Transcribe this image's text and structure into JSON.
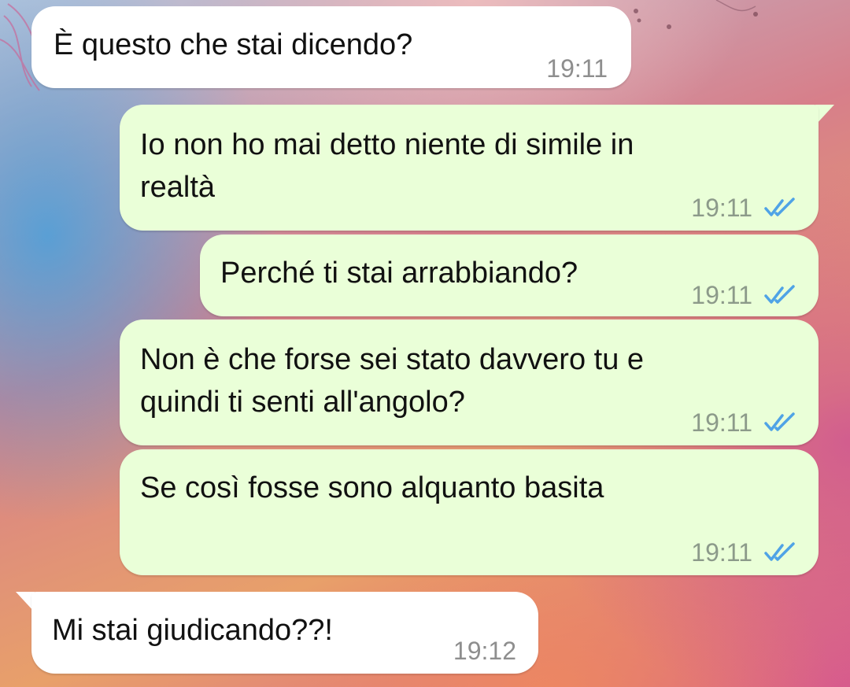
{
  "chat": {
    "messages": [
      {
        "direction": "in",
        "text": "È questo che stai dicendo?",
        "time": "19:11"
      },
      {
        "direction": "out",
        "text": "Io non ho mai detto niente di simile in\nrealtà",
        "time": "19:11",
        "status": "read"
      },
      {
        "direction": "out",
        "text": "Perché ti stai arrabbiando?",
        "time": "19:11",
        "status": "read"
      },
      {
        "direction": "out",
        "text": "Non è che forse sei stato davvero tu e\nquindi ti senti all'angolo?",
        "time": "19:11",
        "status": "read"
      },
      {
        "direction": "out",
        "text": "Se così fosse sono alquanto basita",
        "time": "19:11",
        "status": "read"
      },
      {
        "direction": "in",
        "text": "Mi stai giudicando??!",
        "time": "19:12"
      }
    ]
  },
  "colors": {
    "incoming_bubble": "#ffffff",
    "outgoing_bubble": "#eaffd8",
    "read_ticks": "#4fa3e6"
  },
  "icons": {
    "read_receipt": "double-check-icon"
  }
}
